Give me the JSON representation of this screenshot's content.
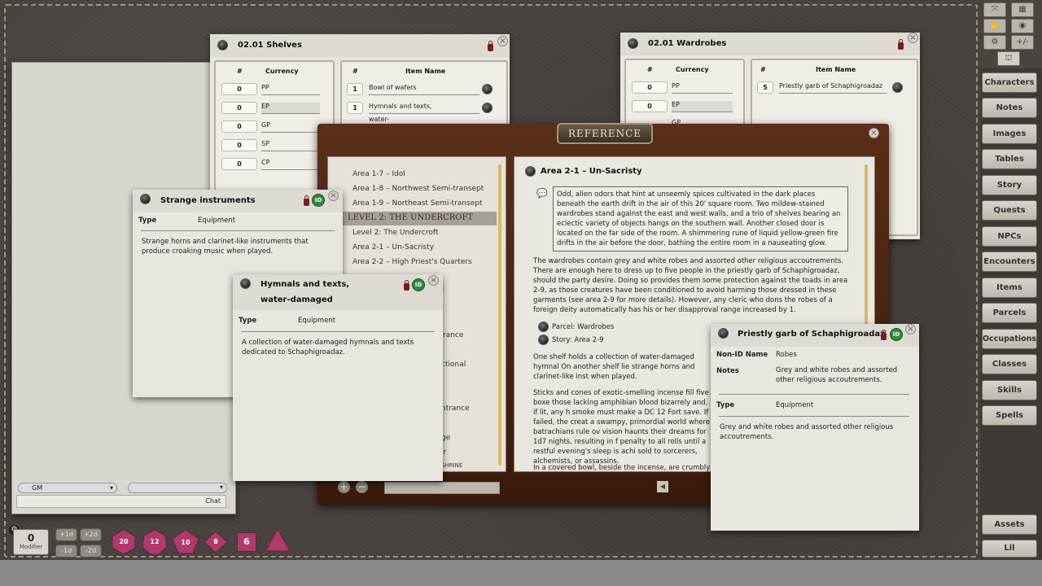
{
  "shelves": {
    "title": "02.01 Shelves",
    "currency_header": "Currency",
    "num_header": "#",
    "item_header": "Item Name",
    "currency": [
      {
        "qty": "0",
        "name": "PP"
      },
      {
        "qty": "0",
        "name": "EP"
      },
      {
        "qty": "0",
        "name": "GP"
      },
      {
        "qty": "0",
        "name": "SP"
      },
      {
        "qty": "0",
        "name": "CP"
      }
    ],
    "items": [
      {
        "qty": "1",
        "name": "Bowl of wafers"
      },
      {
        "qty": "1",
        "name": "Hymnals and texts,",
        "name2": "water-damaged"
      }
    ]
  },
  "wardrobes": {
    "title": "02.01 Wardrobes",
    "currency_header": "Currency",
    "num_header": "#",
    "item_header": "Item Name",
    "currency": [
      {
        "qty": "0",
        "name": "PP"
      },
      {
        "qty": "0",
        "name": "EP"
      },
      {
        "qty": "",
        "name": "GP"
      }
    ],
    "items": [
      {
        "qty": "5",
        "name": "Priestly garb of Schaphigroadaz"
      }
    ]
  },
  "strange": {
    "title": "Strange instruments",
    "type_label": "Type",
    "type_value": "Equipment",
    "desc": "Strange horns and clarinet-like instruments that produce croaking music when played."
  },
  "hymnals": {
    "title1": "Hymnals and texts,",
    "title2": "water-damaged",
    "type_label": "Type",
    "type_value": "Equipment",
    "desc": "A collection of water-damaged hymnals and texts dedicated to Schaphigroadaz."
  },
  "reference": {
    "title": "REFERENCE",
    "list": [
      "Area 1-7 – Idol",
      "Area 1-8 – Northwest Semi-transept",
      "Area 1-9 – Northeast Semi-transept",
      "LEVEL 2: THE UNDERCROFT",
      "Level 2: The Undercroft",
      "Area 2-1 – Un-Sacristy",
      "Area 2-2 – High Priest's Quarters"
    ],
    "partial": [
      "ll",
      "rance",
      "ctional",
      "ntrance",
      "ge",
      "ir",
      "SHRINE"
    ],
    "heading": "Area 2-1 – Un-Sacristy",
    "boxed": "Odd, alien odors that hint at unseemly spices cultivated in the dark places beneath the earth drift in the air of this 20' square room. Two mildew-stained wardrobes stand against the east and west walls, and a trio of shelves bearing an eclectic variety of objects hangs on the southern wall. Another closed door is located on the far side of the room. A shimmering rune of liquid yellow-green fire drifts in the air before the door, bathing the entire room in a nauseating glow.",
    "para1": "The wardrobes contain grey and white robes and assorted other religious accoutrements. There are enough here to dress up to five people in the priestly garb of Schaphigroadaz, should the party desire. Doing so provides them some protection against the toads in area 2-9, as those creatures have been conditioned to avoid harming those dressed in these garments (see area 2-9 for more details). However, any cleric who dons the robes of a foreign deity automatically has his or her disapproval range increased by 1.",
    "link1": "Parcel: Wardrobes",
    "link2": "Story: Area 2-9",
    "para2": "One shelf holds a collection of water-damaged hymnal On another shelf lie strange horns and clarinet-like inst when played.",
    "para3": "Sticks and cones of exotic-smelling incense fill five boxe those lacking amphibian blood bizarrely and, if lit, any h smoke must make a DC 12 Fort save. If failed, the creat a swampy, primordial world where batrachians rule ov vision haunts their dreams for 1d7 nights, resulting in f penalty to all rolls until a restful evening's sleep is achi sold to sorcerers, alchemists, or assassins.",
    "para4": "In a covered bowl, beside the incense, are crumbly cod"
  },
  "priestly": {
    "title": "Priestly garb of Schaphigroadaz",
    "nonid_label": "Non-ID Name",
    "nonid_value": "Robes",
    "notes_label": "Notes",
    "notes_value": "Grey and white robes and assorted other religious accoutrements.",
    "type_label": "Type",
    "type_value": "Equipment",
    "desc": "Grey and white robes and assorted other religious accoutrements."
  },
  "chat": {
    "speaker": "GM",
    "send": "Chat"
  },
  "modifier": {
    "value": "0",
    "label": "Modifier",
    "p1": "+1d",
    "p2": "+2d",
    "m1": "-1d",
    "m2": "-2d"
  },
  "dice": [
    "20",
    "12",
    "10",
    "8",
    "6",
    ""
  ],
  "sidebar": [
    "Characters",
    "Notes",
    "Images",
    "Tables",
    "Story",
    "Quests",
    "NPCs",
    "Encounters",
    "Items",
    "Parcels",
    "Occupations",
    "Classes",
    "Skills",
    "Spells"
  ],
  "assets": "Assets",
  "lib": "Lil",
  "colors": {
    "accent_green": "#2e8b3c",
    "lock_red": "#7a1a23",
    "dice_pink": "#b03a6a"
  }
}
